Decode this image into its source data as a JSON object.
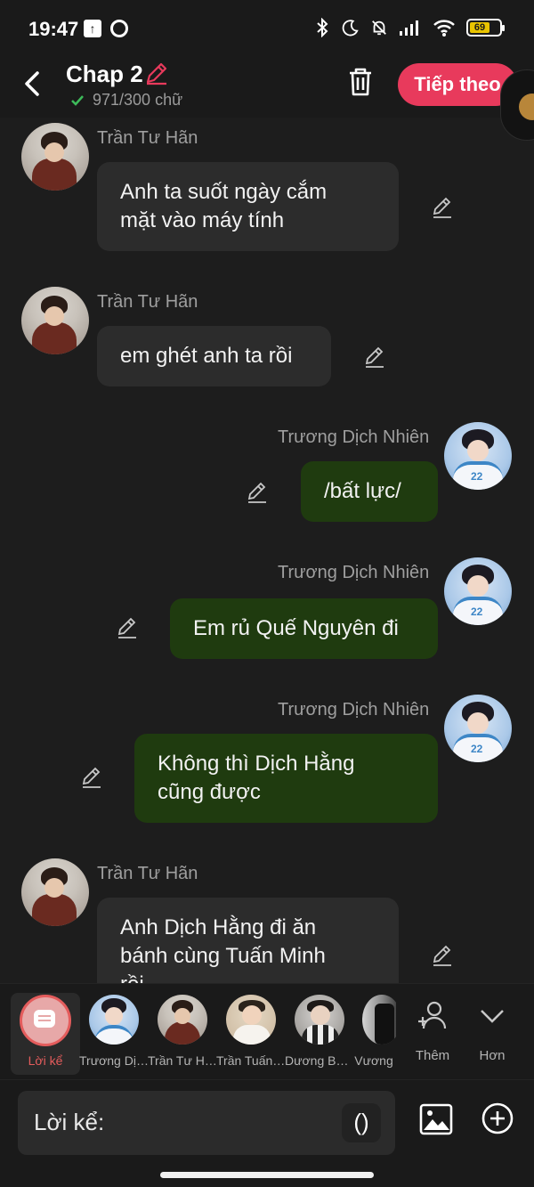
{
  "status_bar": {
    "time": "19:47",
    "battery": "69"
  },
  "header": {
    "title": "Chap 2",
    "word_count": "971/300 chữ",
    "next_label": "Tiếp theo"
  },
  "messages": [
    {
      "sender": "Trần Tư Hãn",
      "side": "left",
      "lines": [
        "Anh ta suốt ngày cắm",
        "mặt vào máy tính"
      ]
    },
    {
      "sender": "Trần Tư Hãn",
      "side": "left",
      "lines": [
        "em ghét anh ta rồi"
      ]
    },
    {
      "sender": "Trương Dịch Nhiên",
      "side": "right",
      "lines": [
        "/bất lực/"
      ]
    },
    {
      "sender": "Trương Dịch Nhiên",
      "side": "right",
      "lines": [
        "Em rủ Quế Nguyên đi"
      ]
    },
    {
      "sender": "Trương Dịch Nhiên",
      "side": "right",
      "lines": [
        "Không thì Dịch Hằng",
        "cũng được"
      ]
    },
    {
      "sender": "Trần Tư Hãn",
      "side": "left",
      "lines": [
        "Anh Dịch Hằng đi ăn",
        "bánh cùng Tuấn Minh",
        "rồi"
      ]
    }
  ],
  "characters": [
    {
      "name": "Lời kể",
      "selected": true
    },
    {
      "name": "Trương Dịch Nhiên"
    },
    {
      "name": "Trần Tư Hãn"
    },
    {
      "name": "Trần Tuấn Minh"
    },
    {
      "name": "Dương Bác Văn"
    },
    {
      "name": "Vương"
    }
  ],
  "actions": {
    "add_label": "Thêm",
    "more_label": "Hơn"
  },
  "input": {
    "label": "Lời kể:",
    "paren": "()"
  },
  "colors": {
    "accent": "#e83a5c",
    "right_bubble": "#1f3b0f",
    "left_bubble": "#2c2c2c",
    "background": "#1d1d1d"
  }
}
